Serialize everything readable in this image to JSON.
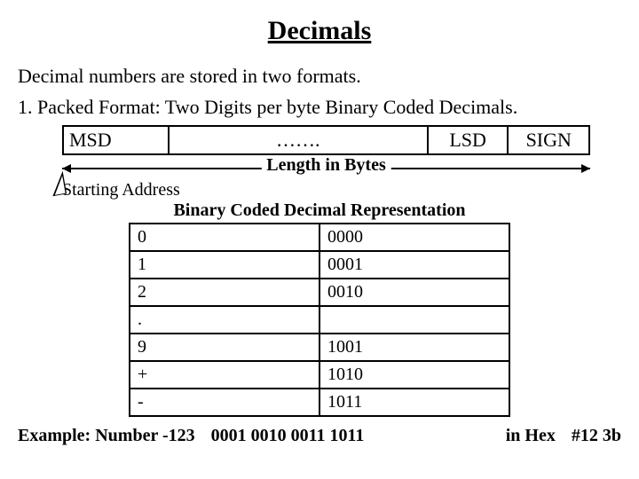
{
  "title": "Decimals",
  "intro_line": "Decimal numbers are stored in two formats.",
  "packed_line": "1. Packed Format: Two Digits per byte Binary Coded Decimals.",
  "byte_layout": {
    "msd": "MSD",
    "middle": "…….",
    "lsd": "LSD",
    "sign": "SIGN"
  },
  "length_label": "Length in Bytes",
  "starting_address_label": "Starting Address",
  "bcd_table_title": "Binary Coded Decimal Representation",
  "bcd_rows": [
    {
      "sym": "0",
      "code": "0000"
    },
    {
      "sym": "1",
      "code": "0001"
    },
    {
      "sym": "2",
      "code": "0010"
    },
    {
      "sym": ".",
      "code": ""
    },
    {
      "sym": "9",
      "code": "1001"
    },
    {
      "sym": "+",
      "code": "1010"
    },
    {
      "sym": "-",
      "code": "1011"
    }
  ],
  "example": {
    "label": "Example: Number -123",
    "binary": "0001 0010 0011 1011",
    "hex_label": "in Hex",
    "hex_value": "#12 3b"
  }
}
